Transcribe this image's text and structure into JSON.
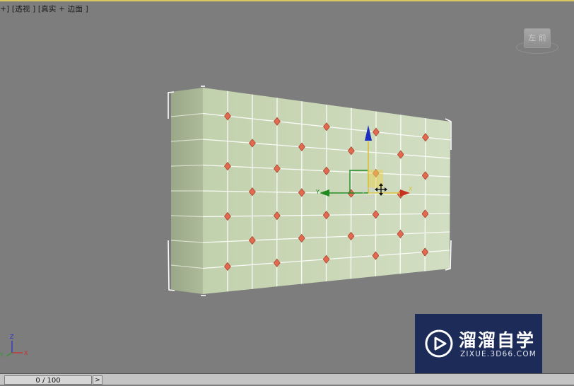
{
  "viewport": {
    "label": "+] [透视 ] [真实 + 边面 ]"
  },
  "viewcube": {
    "face_label": "左 前"
  },
  "gizmo": {
    "x_label": "X",
    "y_label": "Y"
  },
  "axis_tripod": {
    "x_label": "X",
    "y_label": "Y",
    "z_label": "Z"
  },
  "timeline": {
    "frame_text": "0 / 100",
    "next_button": ">"
  },
  "watermark": {
    "title": "溜溜自学",
    "url": "ZIXUE.3D66.COM"
  },
  "colors": {
    "background": "#7d7d7d",
    "mesh_face": "#c8d6b5",
    "vertex": "#e36a50",
    "gizmo_x": "#c83020",
    "gizmo_y": "#1f8a1f",
    "gizmo_z": "#1a2fc0"
  },
  "icons": [
    "move-cursor-icon",
    "play-logo-icon"
  ]
}
